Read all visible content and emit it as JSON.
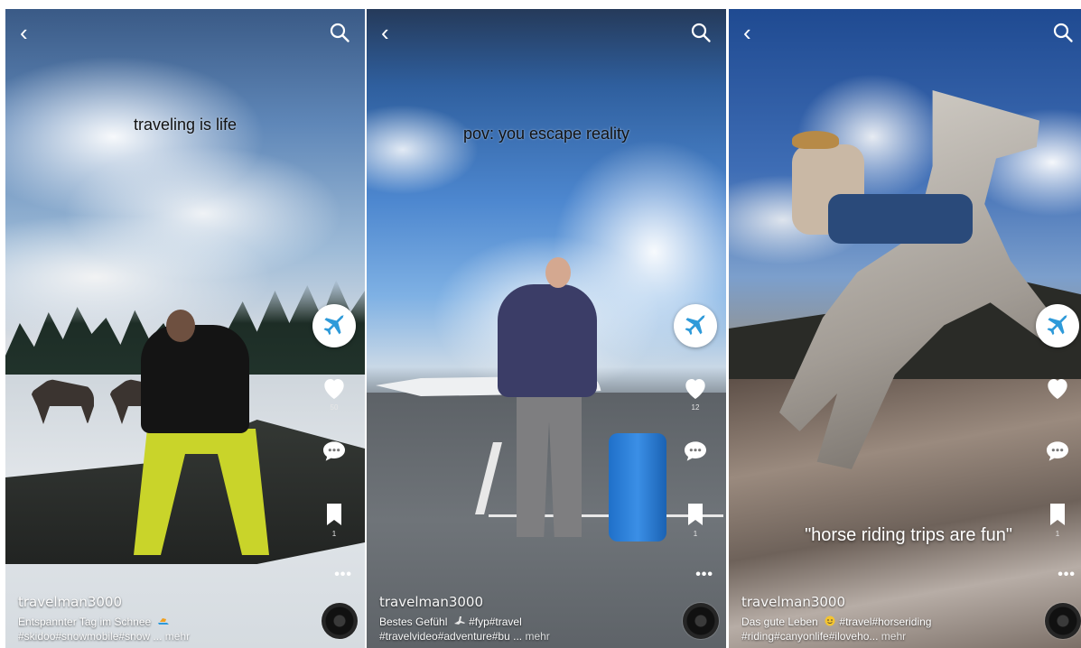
{
  "icons": {
    "back": "chevron-left-icon",
    "search": "search-icon",
    "category": "airplane-icon",
    "like": "heart-icon",
    "comment": "chat-bubble-icon",
    "save": "bookmark-icon",
    "more": "more-dots-icon",
    "sound": "music-disc-icon"
  },
  "colors": {
    "accent": "#2e9ad9",
    "overlay_text": "#111111",
    "ui": "#ffffff"
  },
  "posts": [
    {
      "overlay": "traveling is life",
      "username": "travelman3000",
      "caption": "Entspannter Tag im Schnee",
      "tags": "#skidoo#snowmobile#snow ...",
      "more": "mehr",
      "likes": "50",
      "comments": "",
      "saves": "1",
      "more_dots": "•••"
    },
    {
      "overlay": "pov: you escape reality",
      "username": "travelman3000",
      "caption": "Bestes Gefühl",
      "caption_tags": "#fyp#travel",
      "tags": "#travelvideo#adventure#bu ...",
      "more": "mehr",
      "likes": "12",
      "comments": "",
      "saves": "1",
      "more_dots": "•••"
    },
    {
      "overlay": "\"horse riding trips are fun\"",
      "username": "travelman3000",
      "caption": "Das gute Leben",
      "caption_tags": "#travel#horseriding",
      "tags": "#riding#canyonlife#iloveho...",
      "more": "mehr",
      "likes": "",
      "comments": "",
      "saves": "1",
      "more_dots": "•••"
    }
  ]
}
